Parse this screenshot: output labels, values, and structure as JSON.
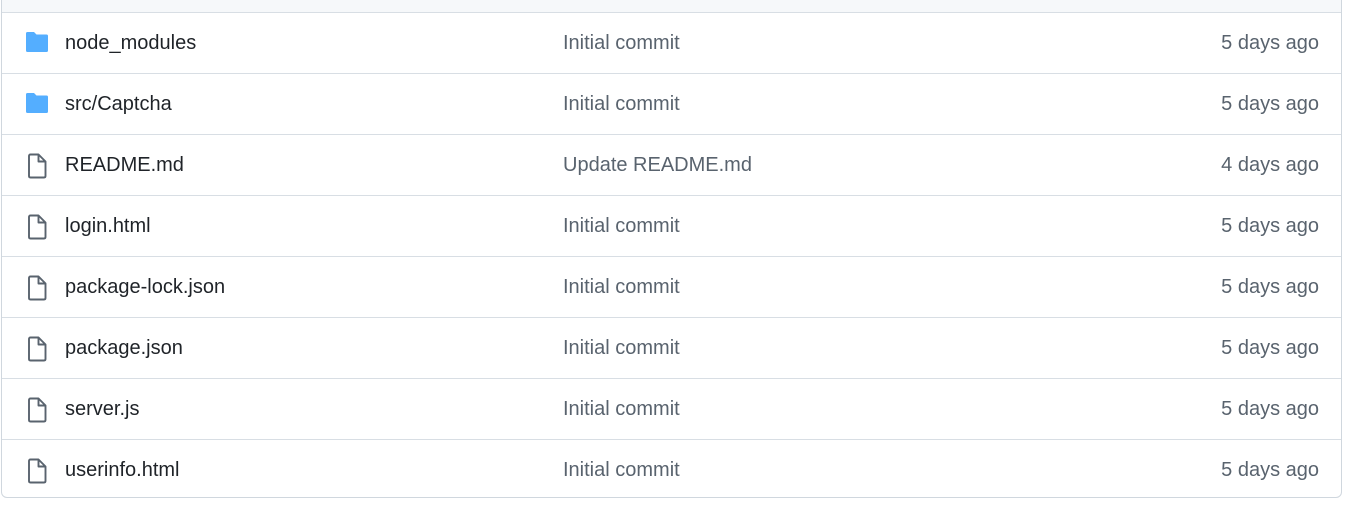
{
  "colors": {
    "folder_icon": "#54aeff",
    "file_icon": "#59636e",
    "name_text": "#1f2328",
    "muted_text": "#59636e",
    "border": "#d0d7de",
    "header_bg": "#f6f8fa"
  },
  "files": [
    {
      "name": "node_modules",
      "type": "folder",
      "icon": "folder-icon",
      "commit": "Initial commit",
      "age": "5 days ago"
    },
    {
      "name": "src/Captcha",
      "type": "folder",
      "icon": "folder-icon",
      "commit": "Initial commit",
      "age": "5 days ago"
    },
    {
      "name": "README.md",
      "type": "file",
      "icon": "file-icon",
      "commit": "Update README.md",
      "age": "4 days ago"
    },
    {
      "name": "login.html",
      "type": "file",
      "icon": "file-icon",
      "commit": "Initial commit",
      "age": "5 days ago"
    },
    {
      "name": "package-lock.json",
      "type": "file",
      "icon": "file-icon",
      "commit": "Initial commit",
      "age": "5 days ago"
    },
    {
      "name": "package.json",
      "type": "file",
      "icon": "file-icon",
      "commit": "Initial commit",
      "age": "5 days ago"
    },
    {
      "name": "server.js",
      "type": "file",
      "icon": "file-icon",
      "commit": "Initial commit",
      "age": "5 days ago"
    },
    {
      "name": "userinfo.html",
      "type": "file",
      "icon": "file-icon",
      "commit": "Initial commit",
      "age": "5 days ago"
    }
  ]
}
